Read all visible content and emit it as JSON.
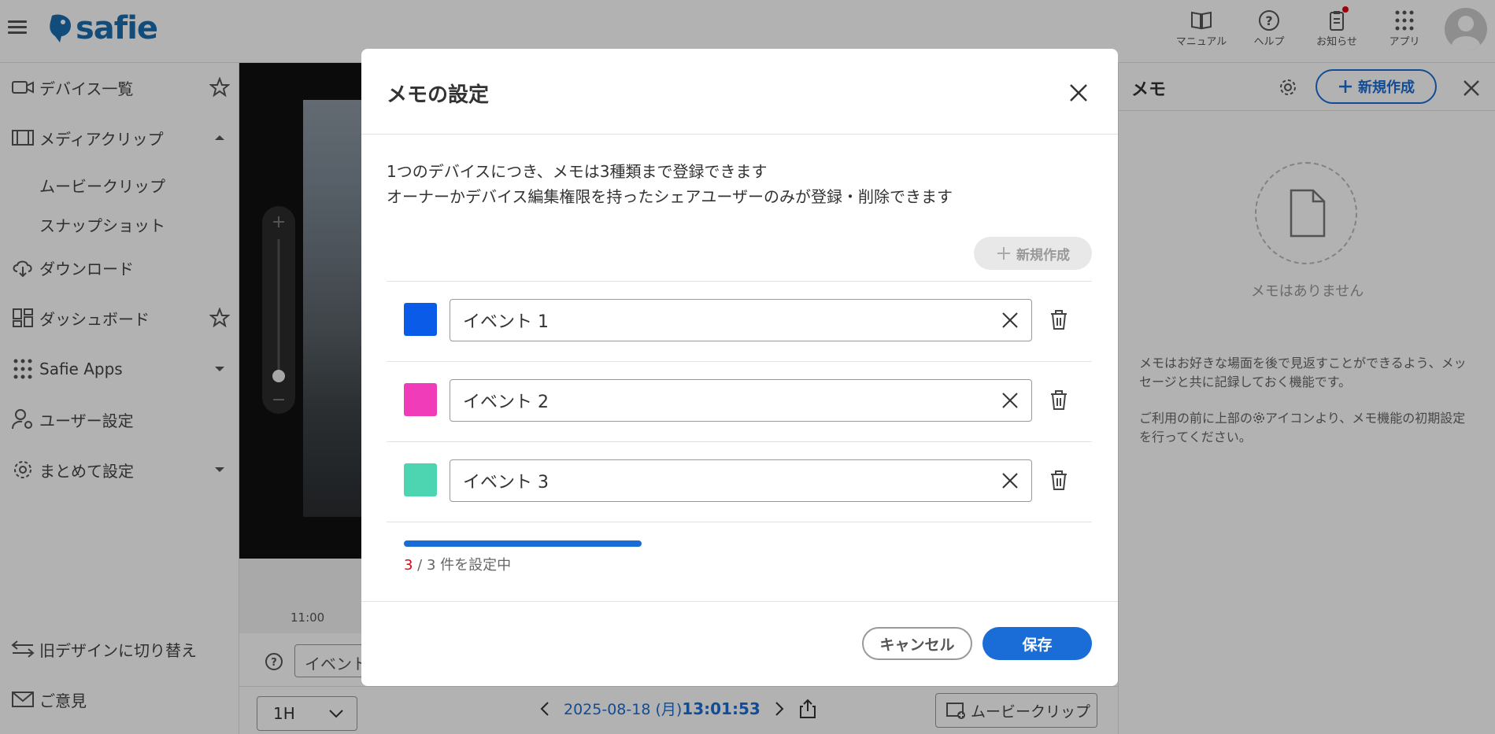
{
  "header": {
    "logo_text": "safie",
    "icons": [
      {
        "name": "manual",
        "label": "マニュアル"
      },
      {
        "name": "help",
        "label": "ヘルプ"
      },
      {
        "name": "news",
        "label": "お知らせ"
      },
      {
        "name": "apps",
        "label": "アプリ"
      }
    ]
  },
  "sidebar": {
    "items": [
      {
        "label": "デバイス一覧"
      },
      {
        "label": "メディアクリップ"
      },
      {
        "label": "ムービークリップ"
      },
      {
        "label": "スナップショット"
      },
      {
        "label": "ダウンロード"
      },
      {
        "label": "ダッシュボード"
      },
      {
        "label": "Safie Apps"
      },
      {
        "label": "ユーザー設定"
      },
      {
        "label": "まとめて設定"
      },
      {
        "label": "旧デザインに切り替え"
      },
      {
        "label": "ご意見"
      }
    ]
  },
  "player": {
    "timeline_tick": "11:00",
    "memo_input_partial": "イベント",
    "range_select": "1H",
    "date": "2025-08-18 (月)",
    "time": "13:01:53",
    "clip_button": "ムービークリップ"
  },
  "right_panel": {
    "title": "メモ",
    "new_button": "新規作成",
    "empty_text": "メモはありません",
    "desc1": "メモはお好きな場面を後で見返すことができるよう、メッセージと共に記録しておく機能です。",
    "desc2_pre": "ご利用の前に上部の",
    "desc2_post": "アイコンより、メモ機能の初期設定を行ってください。"
  },
  "modal": {
    "title": "メモの設定",
    "desc_line1": "1つのデバイスにつき、メモは3種類まで登録できます",
    "desc_line2": "オーナーかデバイス編集権限を持ったシェアユーザーのみが登録・削除できます",
    "new_button": "新規作成",
    "memos": [
      {
        "value": "イベント 1",
        "color": "#0a5ce8"
      },
      {
        "value": "イベント 2",
        "color": "#f03cb8"
      },
      {
        "value": "イベント 3",
        "color": "#4dd4b0"
      }
    ],
    "count_current": "3",
    "count_rest": " / 3 件を設定中",
    "progress": 1.0,
    "cancel": "キャンセル",
    "save": "保存"
  }
}
